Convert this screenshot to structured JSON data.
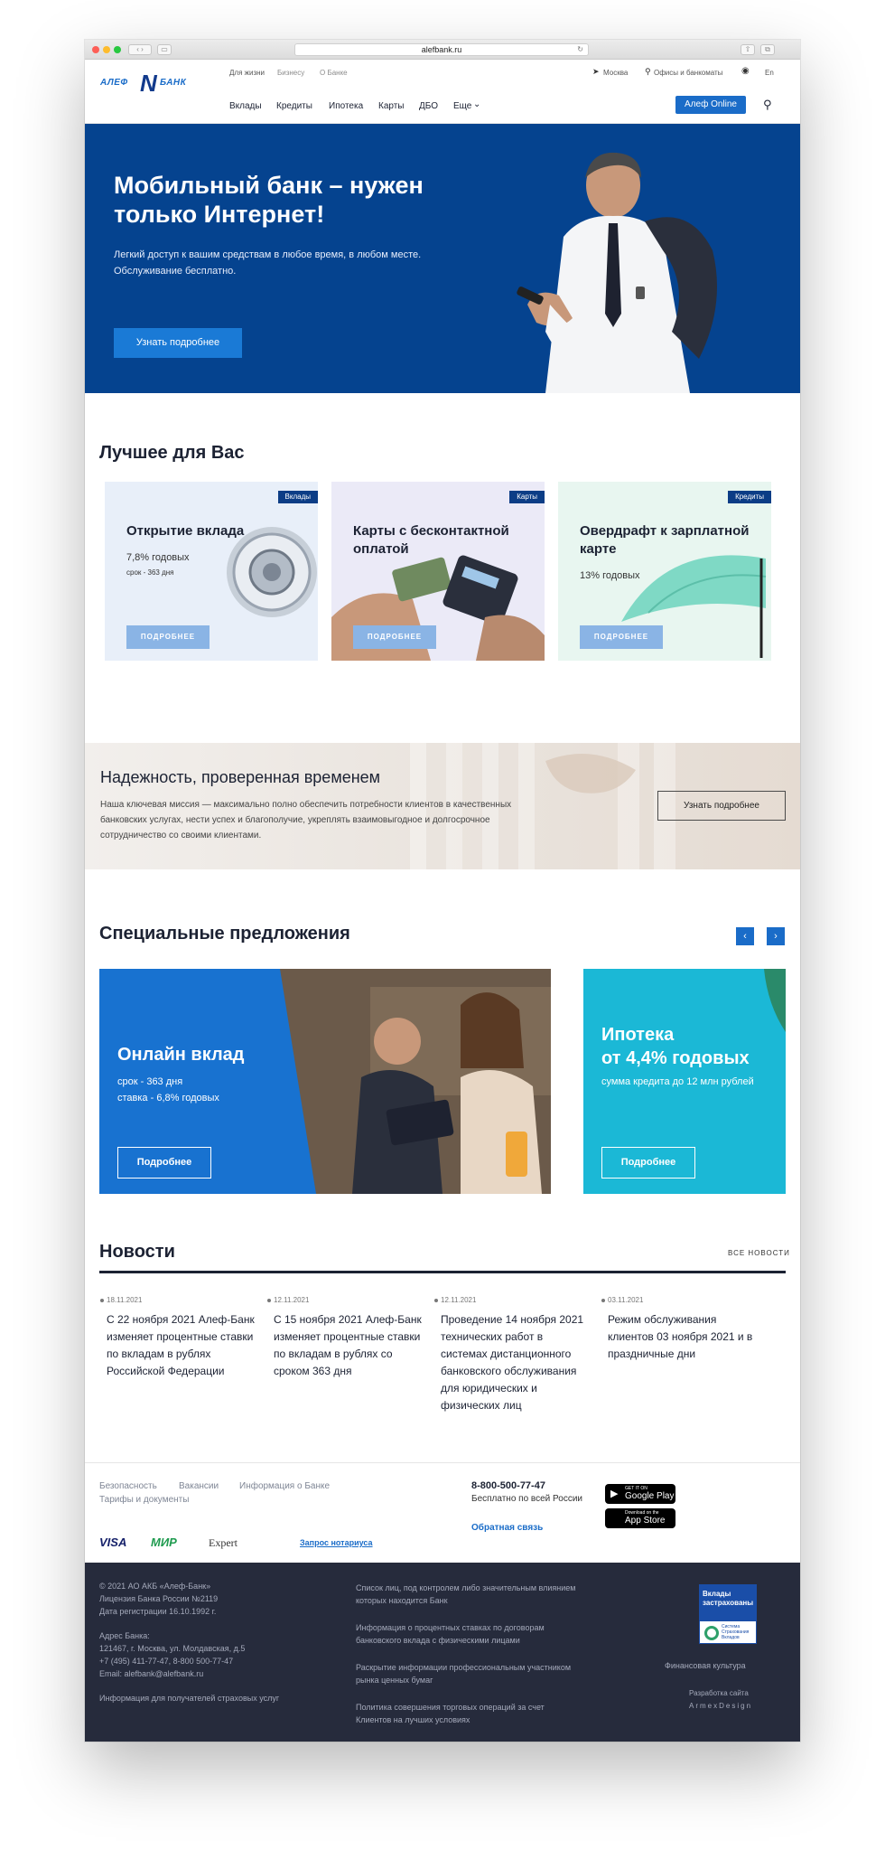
{
  "browser": {
    "url": "alefbank.ru"
  },
  "logo": {
    "left": "АЛЕФ",
    "mid": "N",
    "right": "БАНК"
  },
  "top_links": {
    "life": "Для жизни",
    "business": "Бизнесу",
    "about": "О Банке",
    "city": "Москва",
    "offices": "Офисы и банкоматы",
    "lang": "En"
  },
  "nav": {
    "deposits": "Вклады",
    "credits": "Кредиты",
    "mortgage": "Ипотека",
    "cards": "Карты",
    "dbo": "ДБО",
    "more": "Еще",
    "online": "Алеф Online"
  },
  "hero": {
    "title": "Мобильный банк – нужен только Интернет!",
    "text": "Легкий доступ к вашим средствам в любое время, в любом месте. Обслуживание бесплатно.",
    "button": "Узнать подробнее"
  },
  "best": {
    "title": "Лучшее для Вас",
    "cards": [
      {
        "tag": "Вклады",
        "title": "Открытие вклада",
        "sub": "7,8% годовых",
        "small": "срок - 363 дня",
        "button": "ПОДРОБНЕЕ"
      },
      {
        "tag": "Карты",
        "title": "Карты с бесконтактной оплатой",
        "button": "ПОДРОБНЕЕ"
      },
      {
        "tag": "Кредиты",
        "title": "Овердрафт к зарплатной карте",
        "sub": "13% годовых",
        "button": "ПОДРОБНЕЕ"
      }
    ]
  },
  "reliable": {
    "title": "Надежность, проверенная временем",
    "text": "Наша ключевая миссия — максимально полно обеспечить потребности клиентов в качественных банковских услугах, нести успех и благополучие, укреплять взаимовыгодное и долгосрочное сотрудничество со своими клиентами.",
    "button": "Узнать подробнее"
  },
  "offers": {
    "title": "Специальные предложения",
    "items": [
      {
        "title": "Онлайн вклад",
        "line1": "срок - 363 дня",
        "line2": "ставка - 6,8% годовых",
        "button": "Подробнее"
      },
      {
        "title1": "Ипотека",
        "title2": "от 4,4% годовых",
        "line1": "сумма кредита до 12 млн рублей",
        "button": "Подробнее"
      }
    ]
  },
  "news": {
    "title": "Новости",
    "all": "ВСЕ НОВОСТИ",
    "items": [
      {
        "date": "18.11.2021",
        "text": "С 22 ноября 2021 Алеф-Банк изменяет процентные ставки по вкладам в рублях Российской Федерации"
      },
      {
        "date": "12.11.2021",
        "text": "С 15 ноября 2021 Алеф-Банк изменяет процентные ставки по вкладам в рублях со сроком 363 дня"
      },
      {
        "date": "12.11.2021",
        "text": "Проведение 14 ноября 2021 технических работ в системах дистанционного банковского обслуживания для юридических и физических лиц"
      },
      {
        "date": "03.11.2021",
        "text": "Режим обслуживания клиентов 03 ноября 2021 и в праздничные дни"
      }
    ]
  },
  "footer": {
    "links": {
      "security": "Безопасность",
      "vacancies": "Вакансии",
      "info": "Информация о Банке",
      "tariffs": "Тарифы и документы"
    },
    "phone": "8-800-500-77-47",
    "phone_sub": "Бесплатно по всей России",
    "feedback": "Обратная связь",
    "google": {
      "small": "GET IT ON",
      "big": "Google Play"
    },
    "apple": {
      "small": "Download on the",
      "big": "App Store"
    },
    "visa": "VISA",
    "mir": "МИР",
    "expert": "Expert",
    "notary": "Запрос нотариуса"
  },
  "dark": {
    "c1": "© 2021 АО АКБ «Алеф-Банк»",
    "c2": "Лицензия Банка России №2119",
    "c3": "Дата регистрации 16.10.1992 г.",
    "a1": "Адрес Банка:",
    "a2": "121467, г. Москва, ул. Молдавская, д.5",
    "a3": "+7 (495) 411-77-47, 8-800 500-77-47",
    "a4": "Email: alefbank@alefbank.ru",
    "ins_info": "Информация для получателей страховых услуг",
    "m1": "Список лиц, под контролем либо значительным влиянием которых находится Банк",
    "m2": "Информация о процентных ставках по договорам банковского вклада с физическими лицами",
    "m3": "Раскрытие информации профессиональным участником рынка ценных бумаг",
    "m4": "Политика совершения торговых операций за счет Клиентов на лучших условиях",
    "insured_top": "Вклады застрахованы",
    "insured_bot": "Система Страхования Вкладов",
    "fin_culture": "Финансовая культура",
    "dev": "Разработка сайта",
    "dev_name": "ArmexDesign"
  },
  "colors": {
    "brand_blue": "#1a6cc8",
    "hero_bg": "#05438f",
    "teal": "#1bb8d6",
    "dark_footer": "#262b3c"
  }
}
